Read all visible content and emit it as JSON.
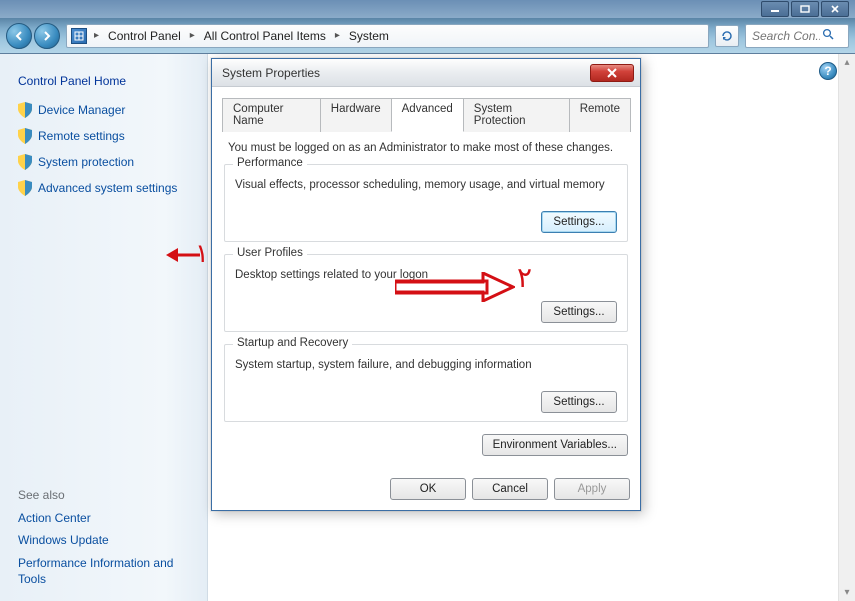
{
  "window": {
    "minimize": "–",
    "maximize": "□",
    "close": "✕"
  },
  "breadcrumbs": {
    "item0": "Control Panel",
    "item1": "All Control Panel Items",
    "item2": "System"
  },
  "search": {
    "placeholder": "Search Con..."
  },
  "sidebar": {
    "home": "Control Panel Home",
    "links": {
      "l0": "Device Manager",
      "l1": "Remote settings",
      "l2": "System protection",
      "l3": "Advanced system settings"
    },
    "seealso": "See also",
    "sa0": "Action Center",
    "sa1": "Windows Update",
    "sa2": "Performance Information and Tools"
  },
  "help": "?",
  "dialog": {
    "title": "System Properties",
    "tabs": {
      "t0": "Computer Name",
      "t1": "Hardware",
      "t2": "Advanced",
      "t3": "System Protection",
      "t4": "Remote"
    },
    "admin_note": "You must be logged on as an Administrator to make most of these changes.",
    "perf": {
      "title": "Performance",
      "desc": "Visual effects, processor scheduling, memory usage, and virtual memory",
      "btn": "Settings..."
    },
    "profiles": {
      "title": "User Profiles",
      "desc": "Desktop settings related to your logon",
      "btn": "Settings..."
    },
    "startup": {
      "title": "Startup and Recovery",
      "desc": "System startup, system failure, and debugging information",
      "btn": "Settings..."
    },
    "env_btn": "Environment Variables...",
    "ok": "OK",
    "cancel": "Cancel",
    "apply": "Apply"
  },
  "annotations": {
    "a1": "١",
    "a2": "٢"
  }
}
